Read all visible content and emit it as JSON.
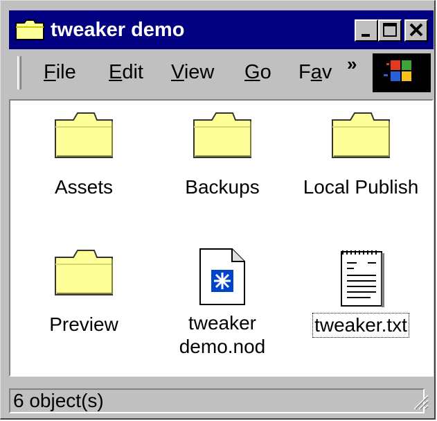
{
  "window": {
    "title": "tweaker demo"
  },
  "menu": {
    "items": [
      {
        "label": "File",
        "mnemonic": "F",
        "rest": "ile"
      },
      {
        "label": "Edit",
        "mnemonic": "E",
        "rest": "dit"
      },
      {
        "label": "View",
        "mnemonic": "V",
        "rest": "iew"
      },
      {
        "label": "Go",
        "mnemonic": "G",
        "rest": "o"
      },
      {
        "label": "Fav",
        "first": "F",
        "mnemonic": "a",
        "rest": "v"
      }
    ],
    "overflow": "»"
  },
  "items": [
    {
      "label": "Assets",
      "icon": "folder-icon"
    },
    {
      "label": "Backups",
      "icon": "folder-icon"
    },
    {
      "label": "Local Publish",
      "icon": "folder-icon"
    },
    {
      "label": "Preview",
      "icon": "folder-icon"
    },
    {
      "label_line1": "tweaker",
      "label_line2": "demo.nod",
      "icon": "nod-file-icon"
    },
    {
      "label": "tweaker.txt",
      "icon": "text-file-icon",
      "selected": true
    }
  ],
  "status": {
    "text": "6 object(s)"
  },
  "colors": {
    "titlebar": "#000080",
    "folder": "#ffff99",
    "face": "#c0c0c0"
  }
}
